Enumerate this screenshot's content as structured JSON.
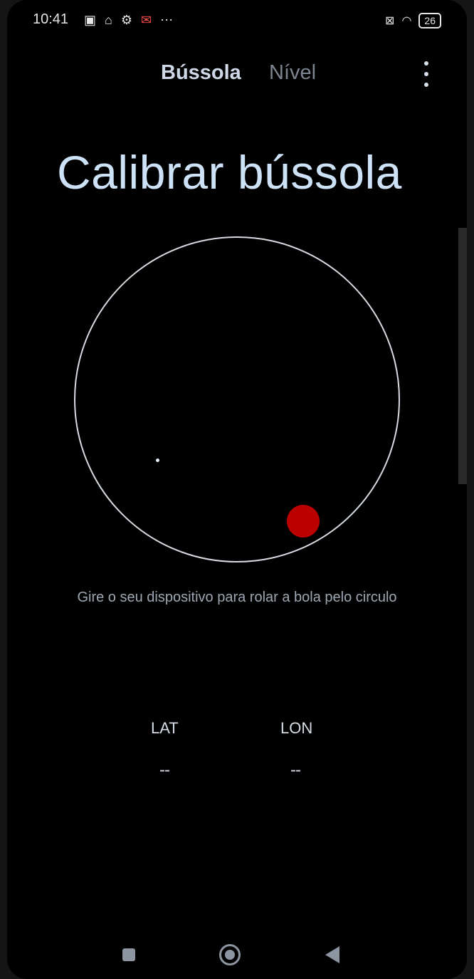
{
  "status": {
    "time": "10:41",
    "battery": "26",
    "notification_icons": [
      "nfc-icon",
      "sim-icon",
      "gear-icon",
      "mail-icon",
      "more-notifications-icon"
    ],
    "right_icons": [
      "no-sim-icon",
      "wifi-icon",
      "battery-icon"
    ]
  },
  "tabs": {
    "compass": "Bússola",
    "level": "Nível"
  },
  "headline": "Calibrar bússola",
  "instruction": "Gire o seu dispositivo para rolar a bola pelo circulo",
  "location": {
    "lat_label": "LAT",
    "lon_label": "LON",
    "lat_value": "--",
    "lon_value": "--"
  },
  "colors": {
    "background": "#000000",
    "accent_text": "#cde2f7",
    "ball": "#bb0000"
  },
  "nav": {
    "recent": "recent-apps-icon",
    "home": "home-icon",
    "back": "back-icon"
  }
}
